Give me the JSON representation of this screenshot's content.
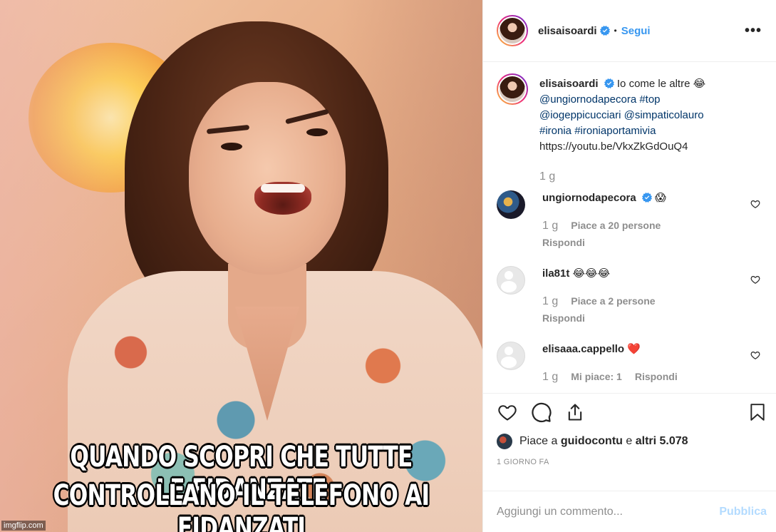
{
  "post": {
    "author": "elisaisoardi",
    "follow_label": "Segui",
    "separator": "•",
    "more_label": "•••",
    "image": {
      "caption_line1": "QUANDO SCOPRI CHE TUTTE LE FIDANZATE",
      "caption_line2": "CONTROLLANO IL TELEFONO AI FIDANZATI",
      "watermark": "imgflip.com"
    }
  },
  "caption": {
    "username": "elisaisoardi",
    "text": "Io come le altre 😂",
    "line2": "@ungiornodapecora #top",
    "line3": "@iogeppicucciari @simpaticolauro",
    "line4": "#ironia #ironiaportamivia",
    "line5": "https://youtu.be/VkxZkGdOuQ4",
    "time": "1 g"
  },
  "comments": [
    {
      "username": "ungiornodapecora",
      "text": "😱",
      "time": "1 g",
      "likes": "Piace a 20 persone",
      "reply": "Rispondi"
    },
    {
      "username": "ila81t",
      "text": "😂😂😂",
      "time": "1 g",
      "likes": "Piace a 2 persone",
      "reply": "Rispondi"
    },
    {
      "username": "elisaaa.cappello",
      "text": "❤️",
      "time": "1 g",
      "likes": "Mi piace: 1",
      "reply": "Rispondi"
    }
  ],
  "likes_summary": {
    "prefix": "Piace a",
    "user": "guidocontu",
    "middle": "e",
    "others": "altri 5.078"
  },
  "timestamp": "1 GIORNO FA",
  "comment_box": {
    "placeholder": "Aggiungi un commento...",
    "publish_label": "Pubblica"
  },
  "colors": {
    "link_blue": "#3897f0",
    "hashtag_blue": "#003569",
    "verified_blue": "#3897f0",
    "muted": "#8e8e8e",
    "publish_disabled": "#b3dbff",
    "heart_red": "#e0245e"
  },
  "icons": [
    "verified-icon",
    "more-options-icon",
    "heart-icon",
    "comment-icon",
    "share-icon",
    "bookmark-icon"
  ]
}
